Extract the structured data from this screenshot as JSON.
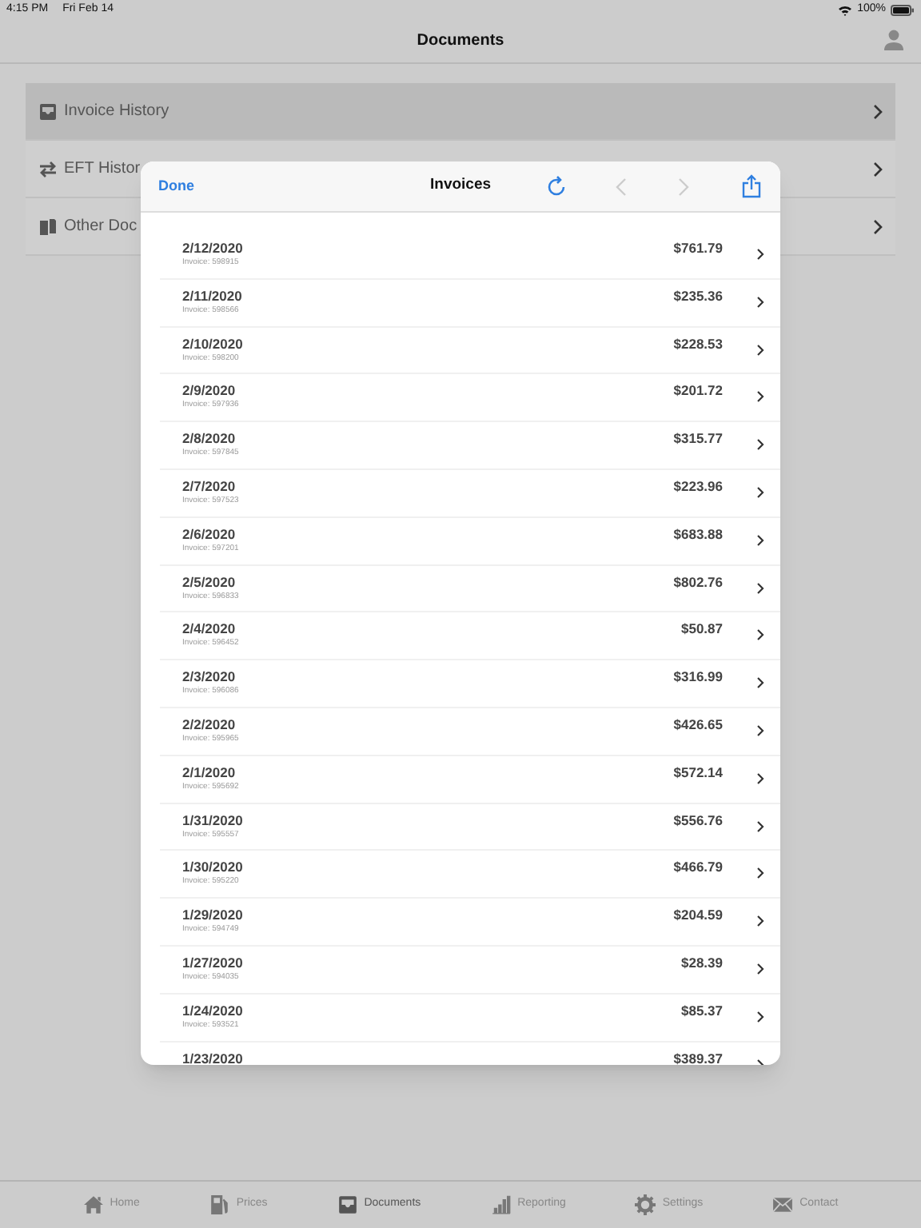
{
  "status_bar": {
    "time": "4:15 PM",
    "date": "Fri Feb 14",
    "battery": "100%"
  },
  "nav_bar": {
    "title": "Documents"
  },
  "menu": [
    {
      "label": "Invoice History",
      "selected": true
    },
    {
      "label": "EFT Histor",
      "selected": false
    },
    {
      "label": "Other Doc",
      "selected": false
    }
  ],
  "modal": {
    "done": "Done",
    "title": "Invoices",
    "back_enabled": false,
    "forward_enabled": false,
    "invoices": [
      {
        "date": "2/12/2020",
        "invoice": "Invoice: 598915",
        "amount": "$761.79"
      },
      {
        "date": "2/11/2020",
        "invoice": "Invoice: 598566",
        "amount": "$235.36"
      },
      {
        "date": "2/10/2020",
        "invoice": "Invoice: 598200",
        "amount": "$228.53"
      },
      {
        "date": "2/9/2020",
        "invoice": "Invoice: 597936",
        "amount": "$201.72"
      },
      {
        "date": "2/8/2020",
        "invoice": "Invoice: 597845",
        "amount": "$315.77"
      },
      {
        "date": "2/7/2020",
        "invoice": "Invoice: 597523",
        "amount": "$223.96"
      },
      {
        "date": "2/6/2020",
        "invoice": "Invoice: 597201",
        "amount": "$683.88"
      },
      {
        "date": "2/5/2020",
        "invoice": "Invoice: 596833",
        "amount": "$802.76"
      },
      {
        "date": "2/4/2020",
        "invoice": "Invoice: 596452",
        "amount": "$50.87"
      },
      {
        "date": "2/3/2020",
        "invoice": "Invoice: 596086",
        "amount": "$316.99"
      },
      {
        "date": "2/2/2020",
        "invoice": "Invoice: 595965",
        "amount": "$426.65"
      },
      {
        "date": "2/1/2020",
        "invoice": "Invoice: 595692",
        "amount": "$572.14"
      },
      {
        "date": "1/31/2020",
        "invoice": "Invoice: 595557",
        "amount": "$556.76"
      },
      {
        "date": "1/30/2020",
        "invoice": "Invoice: 595220",
        "amount": "$466.79"
      },
      {
        "date": "1/29/2020",
        "invoice": "Invoice: 594749",
        "amount": "$204.59"
      },
      {
        "date": "1/27/2020",
        "invoice": "Invoice: 594035",
        "amount": "$28.39"
      },
      {
        "date": "1/24/2020",
        "invoice": "Invoice: 593521",
        "amount": "$85.37"
      },
      {
        "date": "1/23/2020",
        "amount": "$389.37"
      }
    ]
  },
  "tab_bar": [
    {
      "label": "Home",
      "selected": false
    },
    {
      "label": "Prices",
      "selected": false
    },
    {
      "label": "Documents",
      "selected": true
    },
    {
      "label": "Reporting",
      "selected": false
    },
    {
      "label": "Settings",
      "selected": false
    },
    {
      "label": "Contact",
      "selected": false
    }
  ]
}
